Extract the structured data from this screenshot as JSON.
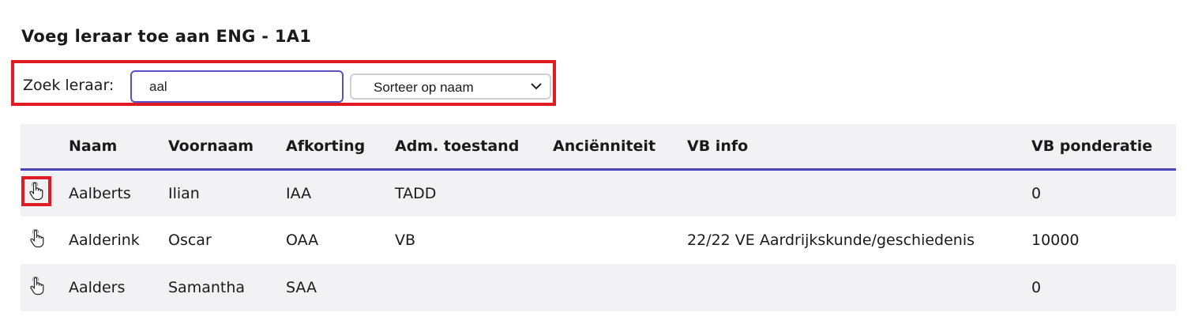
{
  "page": {
    "title": "Voeg leraar toe aan ENG - 1A1"
  },
  "search": {
    "label": "Zoek leraar:",
    "value": "aal",
    "sort_selected": "Sorteer op naam"
  },
  "table": {
    "columns": [
      "Naam",
      "Voornaam",
      "Afkorting",
      "Adm. toestand",
      "Anciënniteit",
      "VB info",
      "VB ponderatie"
    ],
    "rows": [
      {
        "naam": "Aalberts",
        "voornaam": "Ilian",
        "afkorting": "IAA",
        "adm": "TADD",
        "ancien": "",
        "vbinfo": "",
        "vbpond": "0"
      },
      {
        "naam": "Aalderink",
        "voornaam": "Oscar",
        "afkorting": "OAA",
        "adm": "VB",
        "ancien": "",
        "vbinfo": "22/22 VE Aardrijkskunde/geschiedenis",
        "vbpond": "10000"
      },
      {
        "naam": "Aalders",
        "voornaam": "Samantha",
        "afkorting": "SAA",
        "adm": "",
        "ancien": "",
        "vbinfo": "",
        "vbpond": "0"
      }
    ]
  },
  "icons": {
    "row_action": "hand-pointer-icon",
    "sort_toggle": "chevron-down-icon"
  },
  "colors": {
    "highlight": "#e11b22",
    "accent": "#4a44b8",
    "row_stripe": "#f2f2f4"
  }
}
